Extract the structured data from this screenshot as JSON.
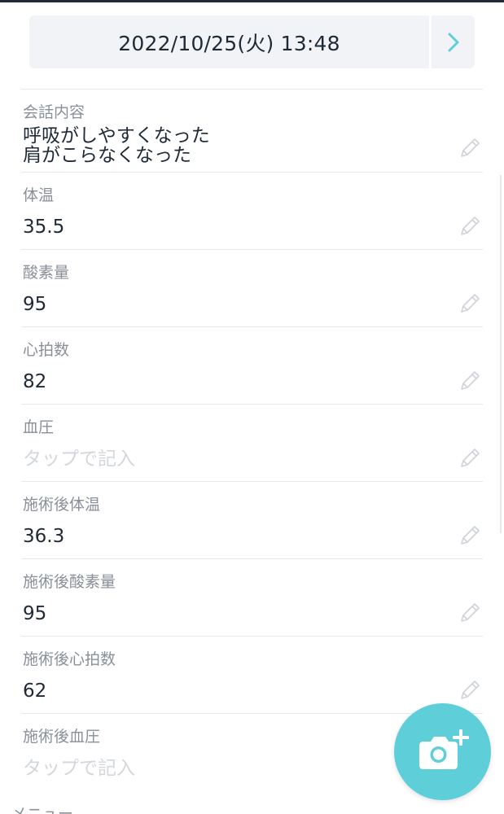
{
  "header": {
    "datetime": "2022/10/25(火) 13:48",
    "next_icon": "chevron-right-icon"
  },
  "fields": [
    {
      "label": "会話内容",
      "value": "呼吸がしやすくなった\n肩がこらなくなった",
      "placeholder": false
    },
    {
      "label": "体温",
      "value": "35.5",
      "placeholder": false
    },
    {
      "label": "酸素量",
      "value": "95",
      "placeholder": false
    },
    {
      "label": "心拍数",
      "value": "82",
      "placeholder": false
    },
    {
      "label": "血圧",
      "value": "タップで記入",
      "placeholder": true
    },
    {
      "label": "施術後体温",
      "value": "36.3",
      "placeholder": false
    },
    {
      "label": "施術後酸素量",
      "value": "95",
      "placeholder": false
    },
    {
      "label": "施術後心拍数",
      "value": "62",
      "placeholder": false
    },
    {
      "label": "施術後血圧",
      "value": "タップで記入",
      "placeholder": true
    }
  ],
  "menu": {
    "label": "メニュー"
  },
  "fab": {
    "icon": "camera-plus-icon"
  },
  "colors": {
    "accent": "#5ecfd9",
    "date_bar_bg": "#f1f3f7",
    "label": "#8a9099",
    "value": "#1f2a37",
    "placeholder": "#d3d6db",
    "edit_icon": "#cfd3d8"
  }
}
